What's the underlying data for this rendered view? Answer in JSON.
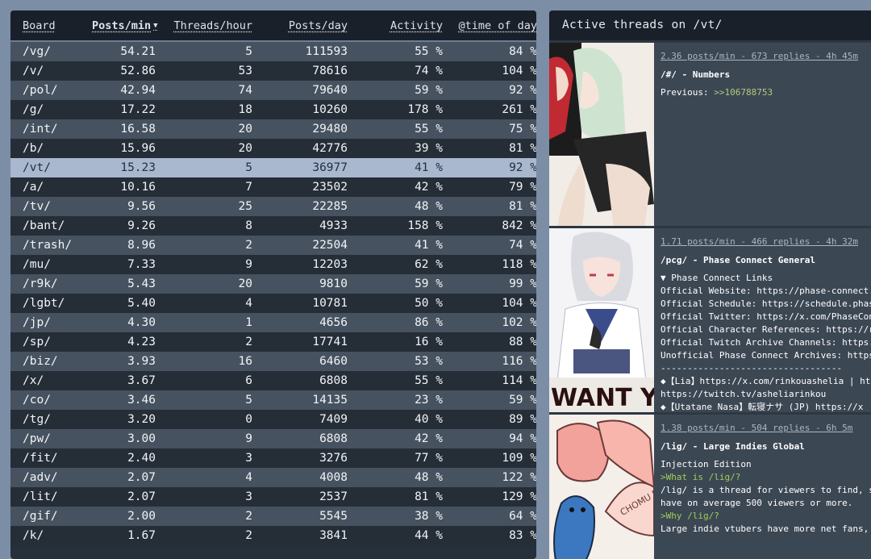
{
  "board_table": {
    "columns": [
      "Board",
      "Posts/min",
      "Threads/hour",
      "Posts/day",
      "Activity",
      "@time of day"
    ],
    "sort_indicator": "▼",
    "selected_board": "/vt/",
    "rows": [
      [
        "/vg/",
        "54.21",
        "5",
        "111593",
        "55 %",
        "84 %"
      ],
      [
        "/v/",
        "52.86",
        "53",
        "78616",
        "74 %",
        "104 %"
      ],
      [
        "/pol/",
        "42.94",
        "74",
        "79640",
        "59 %",
        "92 %"
      ],
      [
        "/g/",
        "17.22",
        "18",
        "10260",
        "178 %",
        "261 %"
      ],
      [
        "/int/",
        "16.58",
        "20",
        "29480",
        "55 %",
        "75 %"
      ],
      [
        "/b/",
        "15.96",
        "20",
        "42776",
        "39 %",
        "81 %"
      ],
      [
        "/vt/",
        "15.23",
        "5",
        "36977",
        "41 %",
        "92 %"
      ],
      [
        "/a/",
        "10.16",
        "7",
        "23502",
        "42 %",
        "79 %"
      ],
      [
        "/tv/",
        "9.56",
        "25",
        "22285",
        "48 %",
        "81 %"
      ],
      [
        "/bant/",
        "9.26",
        "8",
        "4933",
        "158 %",
        "842 %"
      ],
      [
        "/trash/",
        "8.96",
        "2",
        "22504",
        "41 %",
        "74 %"
      ],
      [
        "/mu/",
        "7.33",
        "9",
        "12203",
        "62 %",
        "118 %"
      ],
      [
        "/r9k/",
        "5.43",
        "20",
        "9810",
        "59 %",
        "99 %"
      ],
      [
        "/lgbt/",
        "5.40",
        "4",
        "10781",
        "50 %",
        "104 %"
      ],
      [
        "/jp/",
        "4.30",
        "1",
        "4656",
        "86 %",
        "102 %"
      ],
      [
        "/sp/",
        "4.23",
        "2",
        "17741",
        "16 %",
        "88 %"
      ],
      [
        "/biz/",
        "3.93",
        "16",
        "6460",
        "53 %",
        "116 %"
      ],
      [
        "/x/",
        "3.67",
        "6",
        "6808",
        "55 %",
        "114 %"
      ],
      [
        "/co/",
        "3.46",
        "5",
        "14135",
        "23 %",
        "59 %"
      ],
      [
        "/tg/",
        "3.20",
        "0",
        "7409",
        "40 %",
        "89 %"
      ],
      [
        "/pw/",
        "3.00",
        "9",
        "6808",
        "42 %",
        "94 %"
      ],
      [
        "/fit/",
        "2.40",
        "3",
        "3276",
        "77 %",
        "109 %"
      ],
      [
        "/adv/",
        "2.07",
        "4",
        "4008",
        "48 %",
        "122 %"
      ],
      [
        "/lit/",
        "2.07",
        "3",
        "2537",
        "81 %",
        "129 %"
      ],
      [
        "/gif/",
        "2.00",
        "2",
        "5545",
        "38 %",
        "64 %"
      ],
      [
        "/k/",
        "1.67",
        "2",
        "3841",
        "44 %",
        "83 %"
      ]
    ]
  },
  "threads_panel": {
    "title": "Active threads on /vt/",
    "threads": [
      {
        "stats": "2.36 posts/min - 673 replies - 4h 45m",
        "title": "/#/ - Numbers",
        "lines": [
          {
            "text": "",
            "parts": [
              {
                "t": "Previous: ",
                "c": ""
              },
              {
                "t": ">>106788753",
                "c": "quote"
              }
            ]
          }
        ]
      },
      {
        "stats": "1.71 posts/min - 466 replies - 4h 32m",
        "title": "/pcg/ - Phase Connect General",
        "lines": [
          {
            "parts": [
              {
                "t": "▼ Phase Connect Links",
                "c": ""
              }
            ]
          },
          {
            "parts": [
              {
                "t": "Official Website: https://phase-connect.",
                "c": ""
              }
            ]
          },
          {
            "parts": [
              {
                "t": "Official Schedule: https://schedule.phas",
                "c": ""
              }
            ]
          },
          {
            "parts": [
              {
                "t": "Official Twitter: https://x.com/PhaseCon",
                "c": ""
              }
            ]
          },
          {
            "parts": [
              {
                "t": "Official Character References: https://r",
                "c": ""
              }
            ]
          },
          {
            "parts": [
              {
                "t": "Official Twitch Archive Channels: https:",
                "c": ""
              }
            ]
          },
          {
            "parts": [
              {
                "t": "Unofficial Phase Connect Archives: https",
                "c": ""
              }
            ]
          },
          {
            "parts": [
              {
                "t": "----------------------------------",
                "c": ""
              }
            ]
          },
          {
            "parts": [
              {
                "t": "◆【Lia】https://x.com/rinkouashelia | ht",
                "c": ""
              }
            ]
          },
          {
            "parts": [
              {
                "t": "https://twitch.tv/asheliarinkou",
                "c": ""
              }
            ]
          },
          {
            "parts": [
              {
                "t": "◆【Utatane Nasa】転寝ナサ (JP) https://x",
                "c": ""
              }
            ]
          }
        ]
      },
      {
        "stats": "1.38 posts/min - 504 replies - 6h 5m",
        "title": "/lig/ - Large Indies Global",
        "lines": [
          {
            "parts": [
              {
                "t": "Injection Edition",
                "c": ""
              }
            ]
          },
          {
            "parts": [
              {
                "t": ">What is /lig/?",
                "c": "gt"
              }
            ]
          },
          {
            "parts": [
              {
                "t": "/lig/ is a thread for viewers to find, s",
                "c": ""
              }
            ]
          },
          {
            "parts": [
              {
                "t": "have on average 500 viewers or more.",
                "c": ""
              }
            ]
          },
          {
            "parts": [
              {
                "t": ">Why /lig/?",
                "c": "gt"
              }
            ]
          },
          {
            "parts": [
              {
                "t": "Large indie vtubers have more net fans,",
                "c": ""
              }
            ]
          }
        ]
      }
    ]
  },
  "colors": {
    "page_bg": "#7c8da6",
    "header_bg": "#1a2029",
    "row_light": "#46525f",
    "row_dark": "#252d37",
    "row_selected": "#a9b8cf",
    "greentext": "#9ecf58"
  }
}
